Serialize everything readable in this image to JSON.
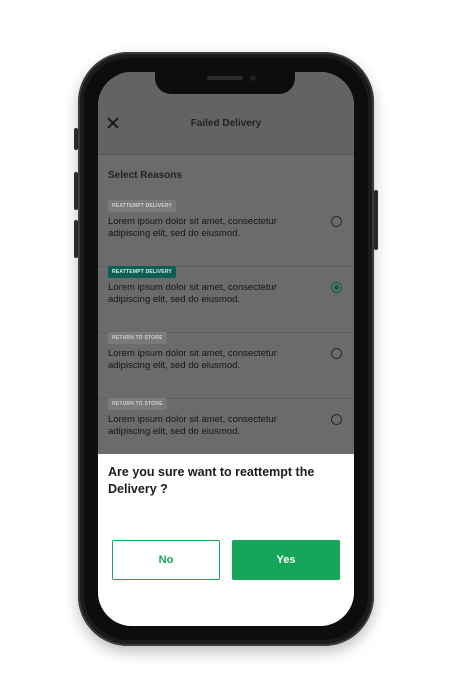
{
  "header": {
    "title": "Failed Delivery"
  },
  "section": {
    "title": "Select Reasons"
  },
  "reasons": [
    {
      "tag": "REATTEMPT DELIVERY",
      "text": "Lorem ipsum dolor sit amet, consectetur adipiscing elit, sed do eiusmod.",
      "selected": false
    },
    {
      "tag": "REATTEMPT DELIVERY",
      "text": "Lorem ipsum dolor sit amet, consectetur adipiscing elit, sed do eiusmod.",
      "selected": true
    },
    {
      "tag": "RETURN TO STORE",
      "text": "Lorem ipsum dolor sit amet, consectetur adipiscing elit, sed do eiusmod.",
      "selected": false
    },
    {
      "tag": "RETURN TO STORE",
      "text": "Lorem ipsum dolor sit amet, consectetur adipiscing elit, sed do eiusmod.",
      "selected": false
    }
  ],
  "dialog": {
    "question": "Are you sure want to reattempt the Delivery ?",
    "no_label": "No",
    "yes_label": "Yes"
  },
  "colors": {
    "accent": "#15a65a",
    "selected_tag": "#0b5f52",
    "overlay": "#6b6b6b"
  },
  "icons": {
    "close": "close-icon",
    "radio": "radio-icon"
  }
}
